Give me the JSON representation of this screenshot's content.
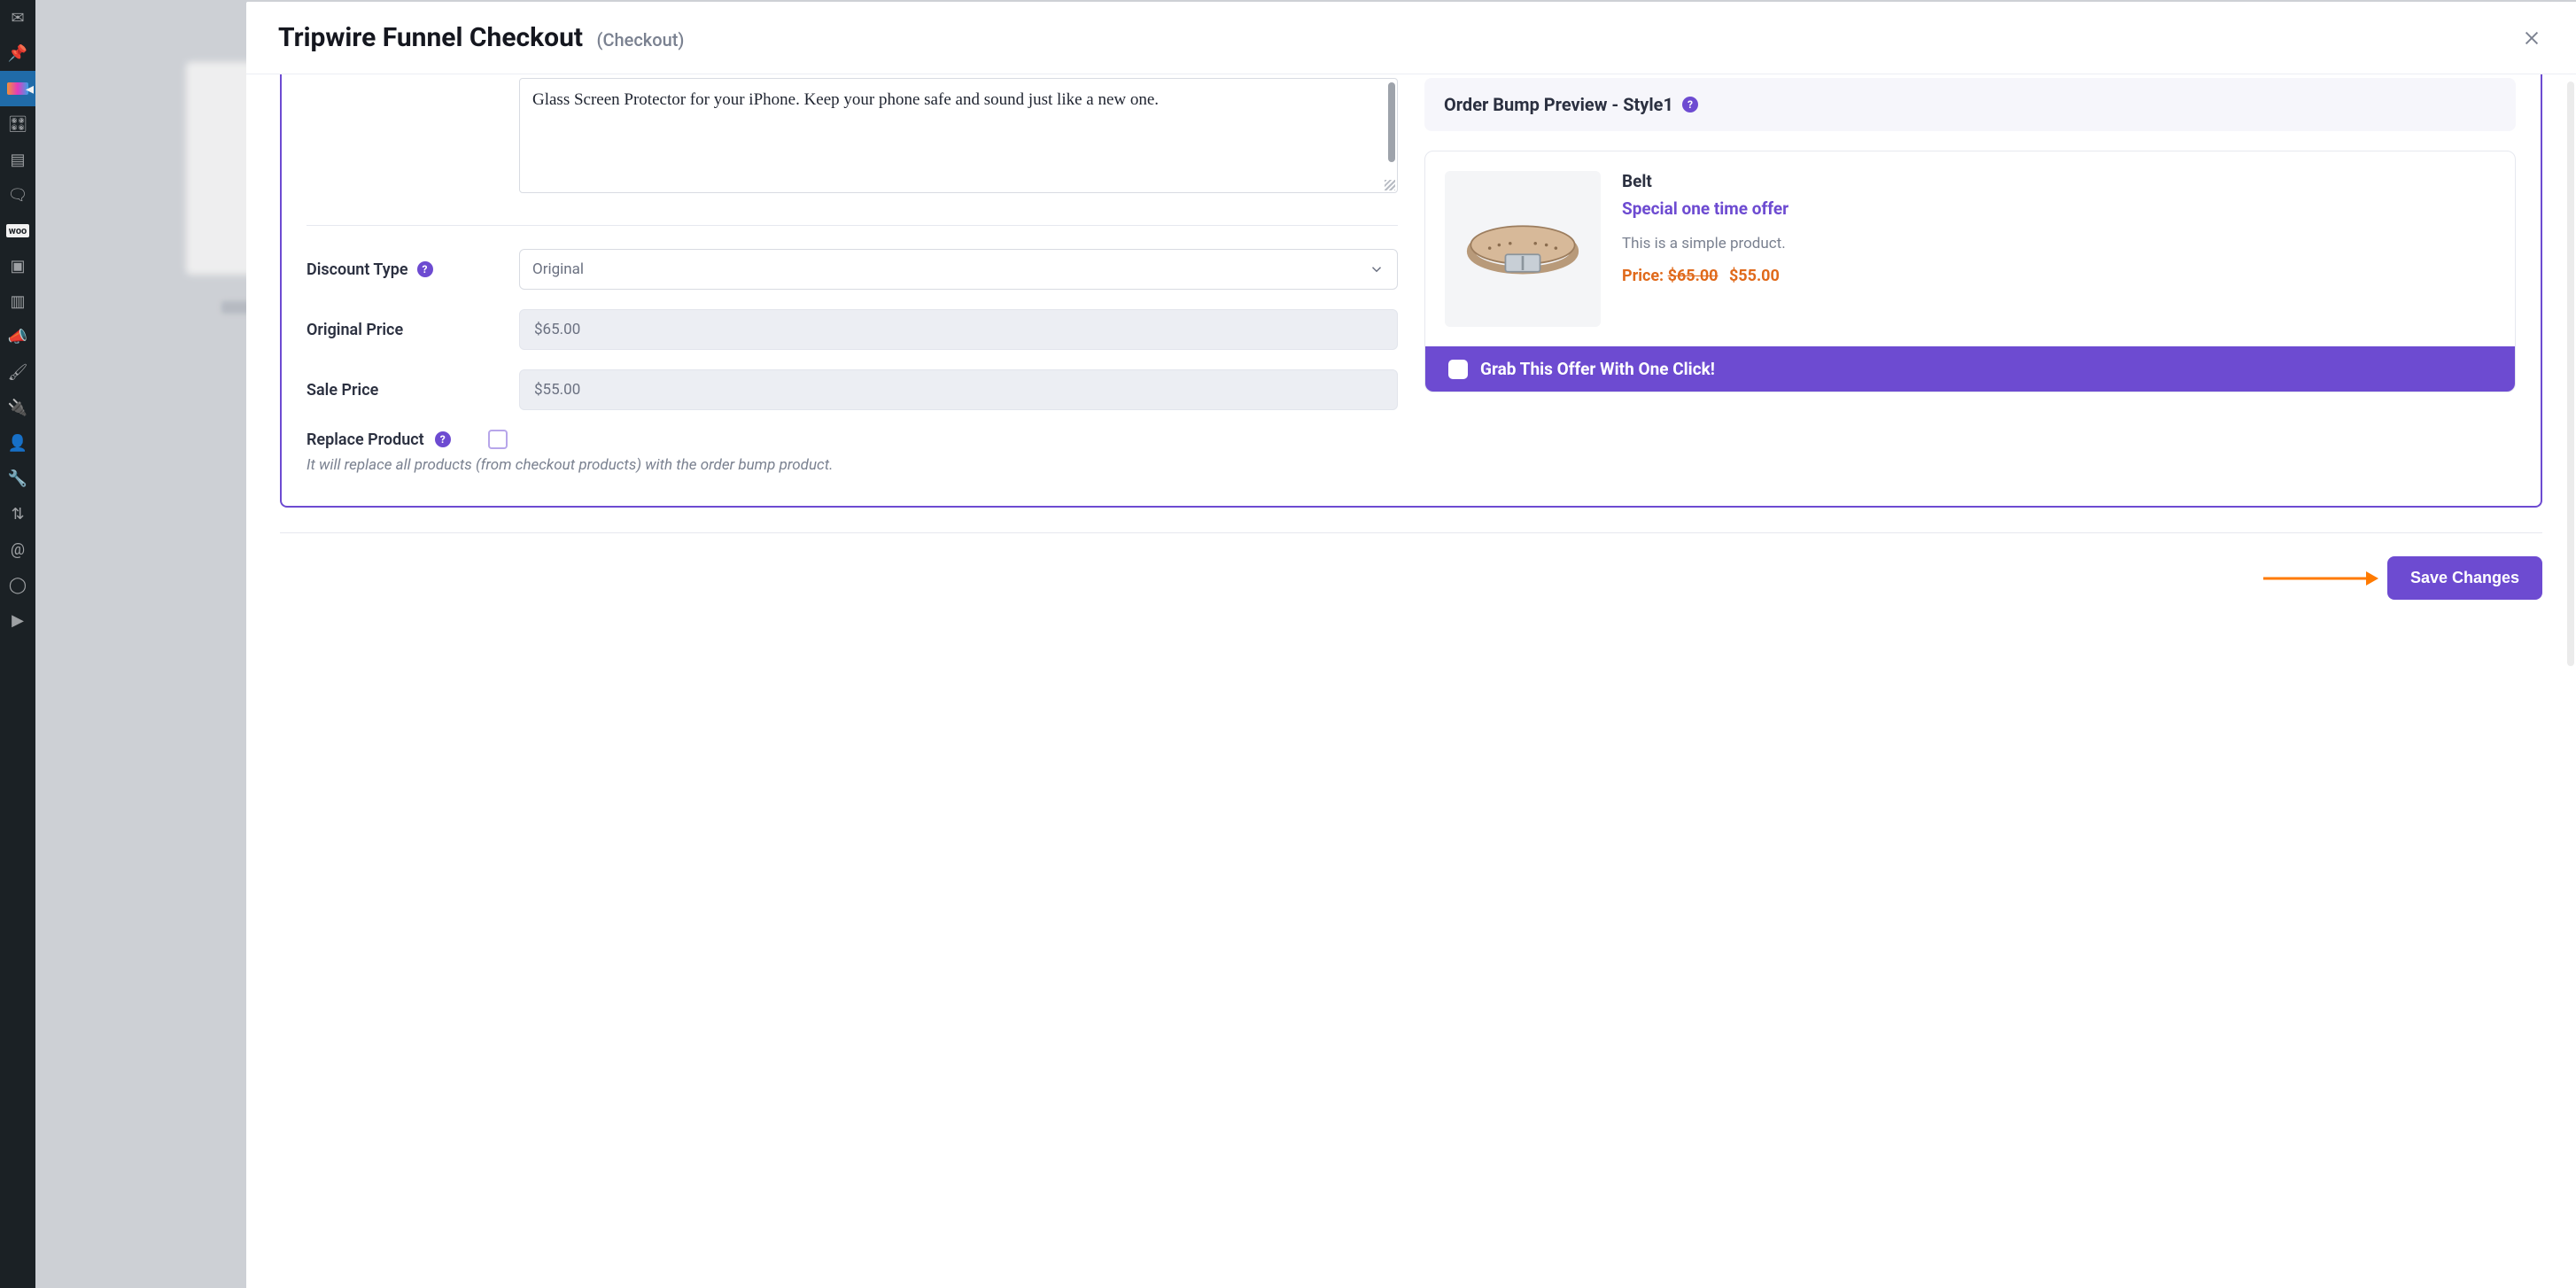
{
  "modal": {
    "title": "Tripwire Funnel Checkout",
    "subtitle": "(Checkout)"
  },
  "form": {
    "description_value": "Glass Screen Protector for your iPhone. Keep your phone safe and sound just like a new one.",
    "discount_type_label": "Discount Type",
    "discount_type_value": "Original",
    "original_price_label": "Original Price",
    "original_price_value": "$65.00",
    "sale_price_label": "Sale Price",
    "sale_price_value": "$55.00",
    "replace_label": "Replace Product",
    "replace_hint": "It will replace all products (from checkout products) with the order bump product."
  },
  "preview": {
    "header": "Order Bump Preview - Style1",
    "product_name": "Belt",
    "offer_line": "Special one time offer",
    "desc": "This is a simple product.",
    "price_label": "Price:",
    "price_was": "$65.00",
    "price_now": "$55.00",
    "cta": "Grab This Offer With One Click!"
  },
  "footer": {
    "save": "Save Changes"
  },
  "colors": {
    "accent": "#6d4bd1",
    "orange": "#e06a1b",
    "arrow": "#ff7a00"
  }
}
